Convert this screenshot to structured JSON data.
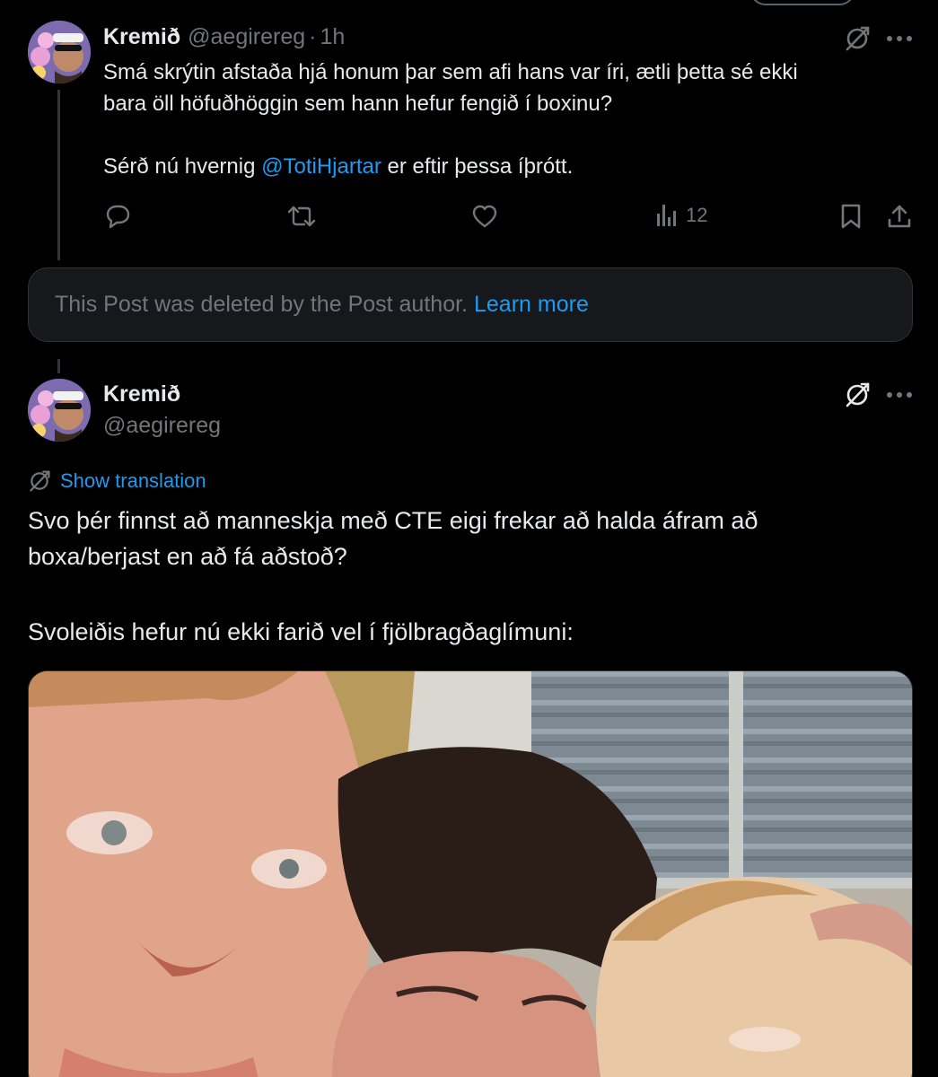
{
  "tweet1": {
    "name": "Kremið",
    "handle": "@aegirereg",
    "sep": "·",
    "time": "1h",
    "line1": "Smá skrýtin afstaða hjá honum þar sem afi hans var íri, ætli þetta sé ekki",
    "line2": "bara öll höfuðhöggin sem hann hefur fengið í boxinu?",
    "line3_pre": "Sérð nú hvernig ",
    "line3_mention": "@TotiHjartar",
    "line3_post": " er eftir þessa íþrótt.",
    "views": "12",
    "icons": [
      "translate-icon",
      "more-icon",
      "reply-icon",
      "retweet-icon",
      "like-icon",
      "views-icon",
      "bookmark-icon",
      "share-icon"
    ]
  },
  "deleted": {
    "text": "This Post was deleted by the Post author.",
    "link": "Learn more"
  },
  "tweet2": {
    "name": "Kremið",
    "handle": "@aegirereg",
    "translation_label": "Show translation",
    "para1_line1": "Svo þér finnst að manneskja með CTE eigi frekar að halda áfram að",
    "para1_line2": "boxa/berjast en að fá aðstoð?",
    "para2": "Svoleiðis hefur nú ekki farið vel í fjölbragðaglímuni:",
    "icons": [
      "translate-icon",
      "more-icon"
    ]
  },
  "colors": {
    "background": "#000000",
    "text": "#e7e9ea",
    "muted": "#71767b",
    "accent": "#1d9bf0",
    "card": "#16181c",
    "border": "#2f3336"
  }
}
